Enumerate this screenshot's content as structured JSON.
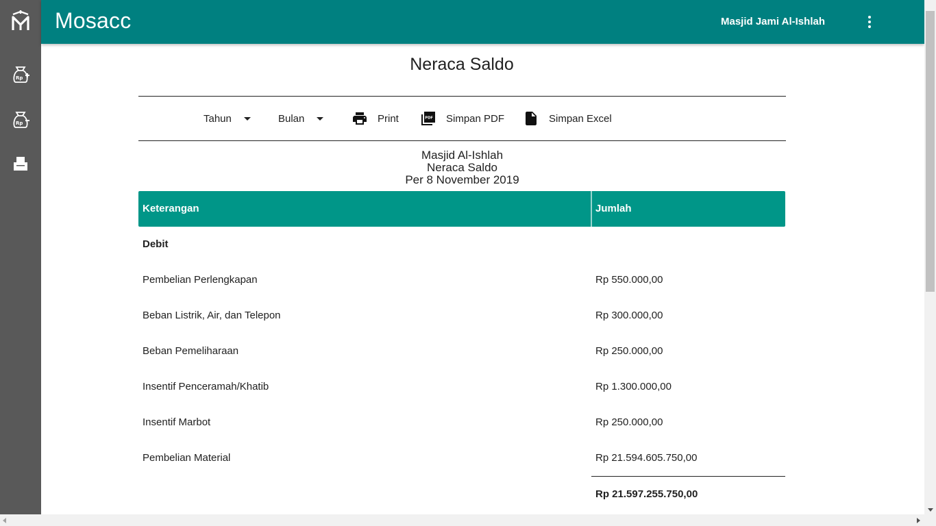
{
  "app": {
    "brand": "Mosacc",
    "organization": "Masjid Jami Al-Ishlah"
  },
  "sidebar": {
    "items": [
      {
        "icon": "money-bag-in-icon"
      },
      {
        "icon": "money-bag-out-icon"
      },
      {
        "icon": "printer-report-icon"
      }
    ]
  },
  "page": {
    "title": "Neraca Saldo"
  },
  "toolbar": {
    "year_label": "Tahun",
    "month_label": "Bulan",
    "print_label": "Print",
    "pdf_label": "Simpan PDF",
    "excel_label": "Simpan Excel"
  },
  "report": {
    "org": "Masjid Al-Ishlah",
    "name": "Neraca Saldo",
    "period": "Per 8 November 2019"
  },
  "table": {
    "headers": {
      "description": "Keterangan",
      "amount": "Jumlah"
    },
    "section": "Debit",
    "rows": [
      {
        "label": "Pembelian Perlengkapan",
        "amount": "Rp 550.000,00"
      },
      {
        "label": "Beban Listrik, Air, dan Telepon",
        "amount": "Rp 300.000,00"
      },
      {
        "label": "Beban Pemeliharaan",
        "amount": "Rp 250.000,00"
      },
      {
        "label": "Insentif Penceramah/Khatib",
        "amount": "Rp 1.300.000,00"
      },
      {
        "label": "Insentif Marbot",
        "amount": "Rp 250.000,00"
      },
      {
        "label": "Pembelian Material",
        "amount": "Rp 21.594.605.750,00"
      }
    ],
    "total": "Rp 21.597.255.750,00"
  },
  "colors": {
    "appbar": "#008080",
    "table_header": "#009688",
    "sidebar": "#595959"
  }
}
